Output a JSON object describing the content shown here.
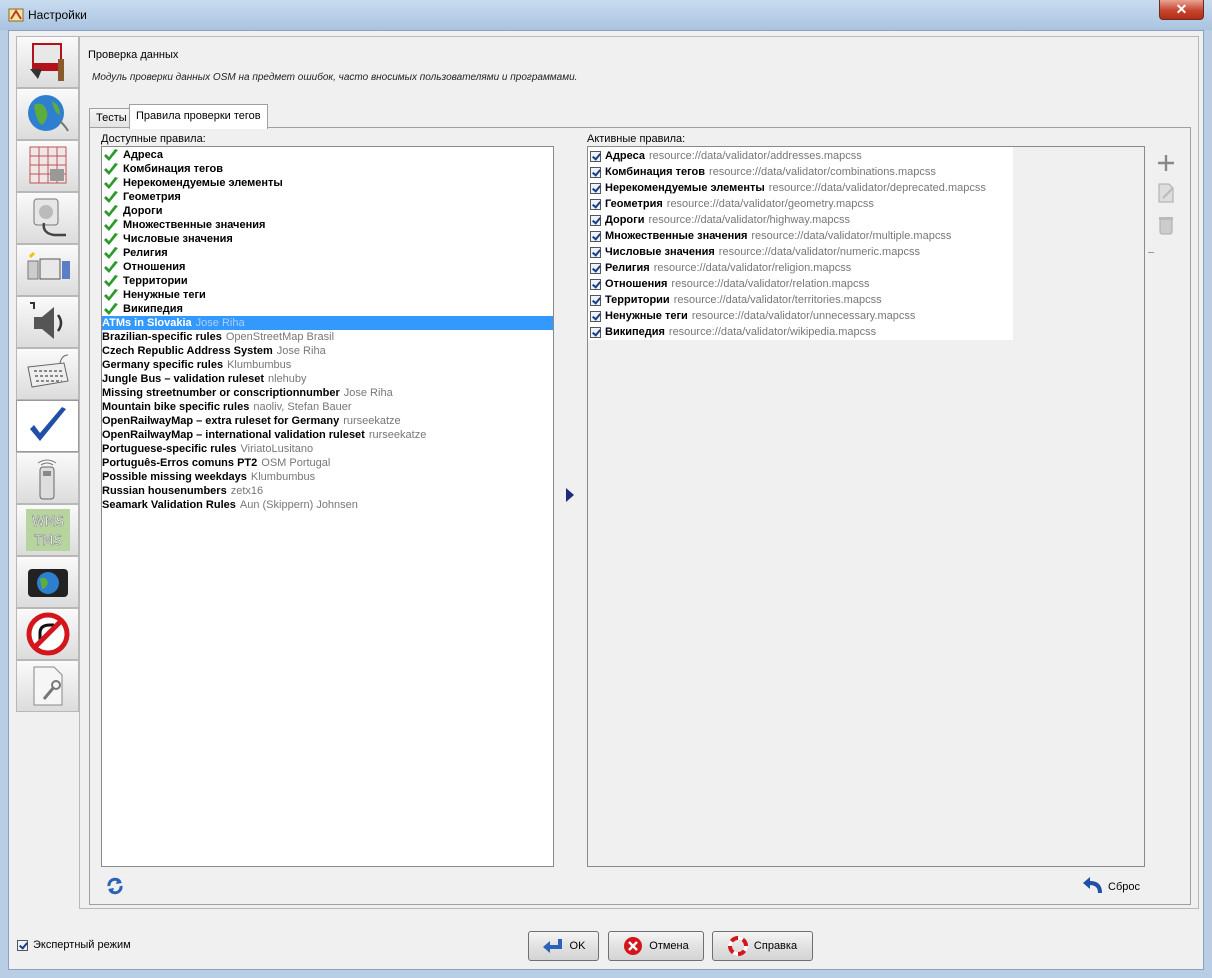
{
  "window": {
    "title": "Настройки",
    "close_label": "✕"
  },
  "header": {
    "title": "Проверка данных",
    "description": "Модуль проверки данных OSM на предмет ошибок, часто вносимых пользователями и программами."
  },
  "tabs": [
    {
      "label": "Тесты",
      "selected": false
    },
    {
      "label": "Правила проверки тегов",
      "selected": true
    }
  ],
  "available": {
    "label": "Доступные правила:",
    "checked_items": [
      "Адреса",
      "Комбинация тегов",
      "Нерекомендуемые элементы",
      "Геометрия",
      "Дороги",
      "Множественные значения",
      "Числовые значения",
      "Религия",
      "Отношения",
      "Территории",
      "Ненужные теги",
      "Википедия"
    ],
    "items": [
      {
        "name": "ATMs in Slovakia",
        "author": "Jose Riha",
        "selected": true
      },
      {
        "name": "Brazilian-specific rules",
        "author": "OpenStreetMap Brasil"
      },
      {
        "name": "Czech Republic Address System",
        "author": "Jose Riha"
      },
      {
        "name": "Germany specific rules",
        "author": "Klumbumbus"
      },
      {
        "name": "Jungle Bus – validation ruleset",
        "author": "nlehuby"
      },
      {
        "name": "Missing streetnumber or conscriptionnumber",
        "author": "Jose Riha"
      },
      {
        "name": "Mountain bike specific rules",
        "author": "naoliv, Stefan Bauer"
      },
      {
        "name": "OpenRailwayMap – extra ruleset for Germany",
        "author": "rurseekatze"
      },
      {
        "name": "OpenRailwayMap – international validation ruleset",
        "author": "rurseekatze"
      },
      {
        "name": "Portuguese-specific rules",
        "author": "ViriatoLusitano"
      },
      {
        "name": "Português-Erros comuns PT2",
        "author": "OSM Portugal"
      },
      {
        "name": "Possible missing weekdays",
        "author": "Klumbumbus"
      },
      {
        "name": "Russian housenumbers",
        "author": "zetx16"
      },
      {
        "name": "Seamark Validation Rules",
        "author": "Aun (Skippern) Johnsen"
      }
    ]
  },
  "active": {
    "label": "Активные правила:",
    "items": [
      {
        "name": "Адреса",
        "src": "resource://data/validator/addresses.mapcss"
      },
      {
        "name": "Комбинация тегов",
        "src": "resource://data/validator/combinations.mapcss"
      },
      {
        "name": "Нерекомендуемые элементы",
        "src": "resource://data/validator/deprecated.mapcss"
      },
      {
        "name": "Геометрия",
        "src": "resource://data/validator/geometry.mapcss"
      },
      {
        "name": "Дороги",
        "src": "resource://data/validator/highway.mapcss"
      },
      {
        "name": "Множественные значения",
        "src": "resource://data/validator/multiple.mapcss"
      },
      {
        "name": "Числовые значения",
        "src": "resource://data/validator/numeric.mapcss"
      },
      {
        "name": "Религия",
        "src": "resource://data/validator/religion.mapcss"
      },
      {
        "name": "Отношения",
        "src": "resource://data/validator/relation.mapcss"
      },
      {
        "name": "Территории",
        "src": "resource://data/validator/territories.mapcss"
      },
      {
        "name": "Ненужные теги",
        "src": "resource://data/validator/unnecessary.mapcss"
      },
      {
        "name": "Википедия",
        "src": "resource://data/validator/wikipedia.mapcss"
      }
    ]
  },
  "reset_label": "Сброс",
  "footer": {
    "expert_mode_label": "Экспертный режим",
    "ok_label": "OK",
    "cancel_label": "Отмена",
    "help_label": "Справка"
  },
  "colors": {
    "selection": "#3399ff",
    "check_green": "#2e9a2e",
    "source_gray": "#777777"
  }
}
